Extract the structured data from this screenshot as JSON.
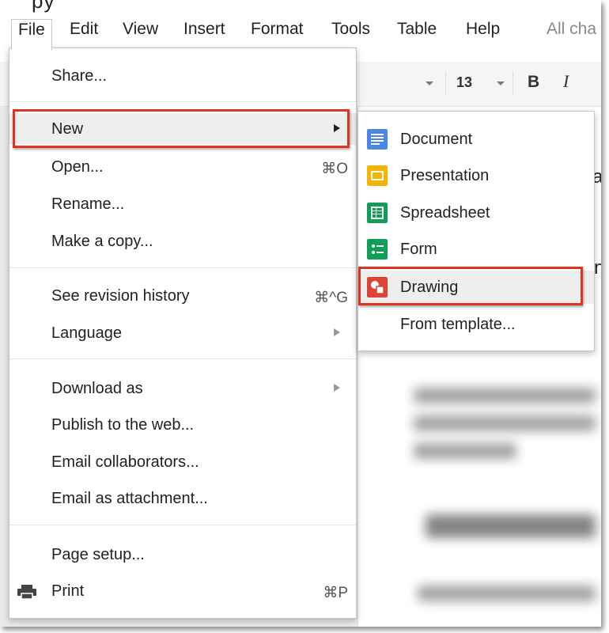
{
  "menubar": {
    "cut_title": "py",
    "items": [
      "File",
      "Edit",
      "View",
      "Insert",
      "Format",
      "Tools",
      "Table",
      "Help"
    ],
    "status": "All cha"
  },
  "toolbar": {
    "font_size": "13",
    "bold": "B",
    "italic": "I"
  },
  "file_menu": {
    "share": "Share...",
    "new": "New",
    "open": "Open...",
    "open_shortcut": "⌘O",
    "rename": "Rename...",
    "make_copy": "Make a copy...",
    "revision_history": "See revision history",
    "revision_shortcut": "⌘^G",
    "language": "Language",
    "download_as": "Download as",
    "publish": "Publish to the web...",
    "email_collaborators": "Email collaborators...",
    "email_attachment": "Email as attachment...",
    "page_setup": "Page setup...",
    "print": "Print",
    "print_shortcut": "⌘P"
  },
  "new_submenu": {
    "items": [
      {
        "label": "Document",
        "icon": "docs-icon",
        "color": "#4a86e8"
      },
      {
        "label": "Presentation",
        "icon": "slides-icon",
        "color": "#f4b400"
      },
      {
        "label": "Spreadsheet",
        "icon": "sheets-icon",
        "color": "#0f9d58"
      },
      {
        "label": "Form",
        "icon": "forms-icon",
        "color": "#0f9d58"
      },
      {
        "label": "Drawing",
        "icon": "drawing-icon",
        "color": "#db4437"
      },
      {
        "label": "From template...",
        "icon": "",
        "color": ""
      }
    ]
  },
  "doc_peek": {
    "right_chars": [
      "a",
      "n"
    ]
  },
  "colors": {
    "highlight_box": "#e0341f",
    "menu_hover": "#eeeeee"
  }
}
